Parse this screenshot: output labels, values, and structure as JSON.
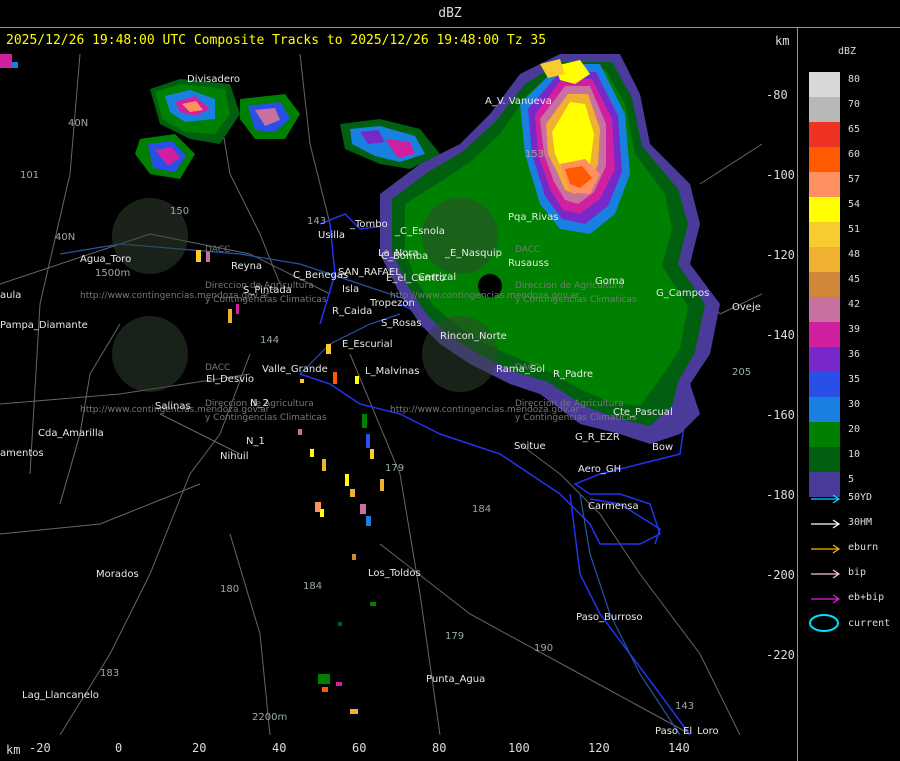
{
  "header": {
    "title": "dBZ"
  },
  "map": {
    "subtitle": "2025/12/26 19:48:00 UTC Composite Tracks to 2025/12/26 19:48:00 Tz 35",
    "km_label": "km",
    "x_ticks": [
      "-20",
      "0",
      "20",
      "40",
      "60",
      "80",
      "100",
      "120",
      "140"
    ],
    "y_ticks": [
      "-80",
      "-100",
      "-120",
      "-140",
      "-160",
      "-180",
      "-200",
      "-220"
    ],
    "places": {
      "divisadero": "Divisadero",
      "a_v_vanueva": "A_V. Vanueva",
      "usilla": "Usilla",
      "tombo": "_Tombo",
      "esnola": "_C_Esnola",
      "la_nora": "La_Nora",
      "nasquip": "_E_Nasquip",
      "rusauss": "Rusauss",
      "pqa_rivas": "Pqa_Rivas",
      "goma": "Goma",
      "reyna": "Reyna",
      "c_benegas": "C_Benegas",
      "san_rafael": "SAN_RAFAEL",
      "el_cerrito": "E_el_Cerrito",
      "c_bomba": "C_Bomba",
      "isla": "Isla",
      "s_pintada": "S_Pintada",
      "tropezon": "Tropezon",
      "rama_caida": "R_Caida",
      "s_rosas": "S_Rosas",
      "g_campos": "G_Campos",
      "ovejeria": "Oveje",
      "agua_toro": "Agua_Toro",
      "aula": "aula",
      "pampa_diamante": "Pampa_Diamante",
      "rincon_norte": "Rincon_Norte",
      "e_escurial": "E_Escurial",
      "el_desvio": "El_Desvio",
      "valle_grande": "Valle_Grande",
      "las_malvinas": "L_Malvinas",
      "rama_sol": "Rama_Sol",
      "r_padre": "R_Padre",
      "salinas": "Salinas",
      "cda_amarilla": "Cda_Amarilla",
      "n_2": "N_2",
      "n_1": "N_1",
      "nihuil": "Nihuil",
      "amentos": "amentos",
      "soitue": "Soitue",
      "g_la_ezr": "G_R_EZR",
      "bowen": "Bow",
      "aero_gh": "Aero_GH",
      "carmensa": "Carmensa",
      "morados": "Morados",
      "los_toldos": "Los_Toldos",
      "paso_burroso": "Paso_Burroso",
      "lag_llancanelo": "Lag_Llancanelo",
      "punta_agua": "Punta_Agua",
      "paso_el_loro": "Paso_El_Loro",
      "cte_pascual": "Cte_Pascual",
      "el_carrizal": "Carrizal"
    },
    "route_numbers": [
      "40N",
      "40N",
      "101",
      "150",
      "143",
      "144",
      "179",
      "153",
      "184",
      "180",
      "184",
      "183",
      "179",
      "190",
      "143",
      "205",
      "1500m",
      "2200m"
    ],
    "watermark": {
      "brand": "DACC",
      "line1": "Direccion de Agricultura",
      "line2": "y Contingencias Climaticas",
      "url": "http://www.contingencias.mendoza.gov.ar"
    }
  },
  "legend": {
    "title": "dBZ",
    "scale": [
      {
        "label": "80",
        "color": "#d8d8d8"
      },
      {
        "label": "70",
        "color": "#b8b8b8"
      },
      {
        "label": "65",
        "color": "#ee3322"
      },
      {
        "label": "60",
        "color": "#ff5a00"
      },
      {
        "label": "57",
        "color": "#ff9060"
      },
      {
        "label": "54",
        "color": "#ffff00"
      },
      {
        "label": "51",
        "color": "#f8cc30"
      },
      {
        "label": "48",
        "color": "#f0b030"
      },
      {
        "label": "45",
        "color": "#d08838"
      },
      {
        "label": "42",
        "color": "#c870a0"
      },
      {
        "label": "39",
        "color": "#d020a0"
      },
      {
        "label": "36",
        "color": "#7828c8"
      },
      {
        "label": "35",
        "color": "#2850e8"
      },
      {
        "label": "30",
        "color": "#1880e0"
      },
      {
        "label": "20",
        "color": "#008000"
      },
      {
        "label": "10",
        "color": "#006010"
      },
      {
        "label": "5",
        "color": "#4a3a9a"
      }
    ],
    "tracks": [
      {
        "label": "50YD",
        "color": "#00e0ff"
      },
      {
        "label": "30HM",
        "color": "#ffffff"
      },
      {
        "label": "eburn",
        "color": "#ffb000"
      },
      {
        "label": "bip",
        "color": "#ffc0e0"
      },
      {
        "label": "eb+bip",
        "color": "#e020e0"
      }
    ],
    "current_label": "current",
    "current_color": "#00e0ff"
  }
}
